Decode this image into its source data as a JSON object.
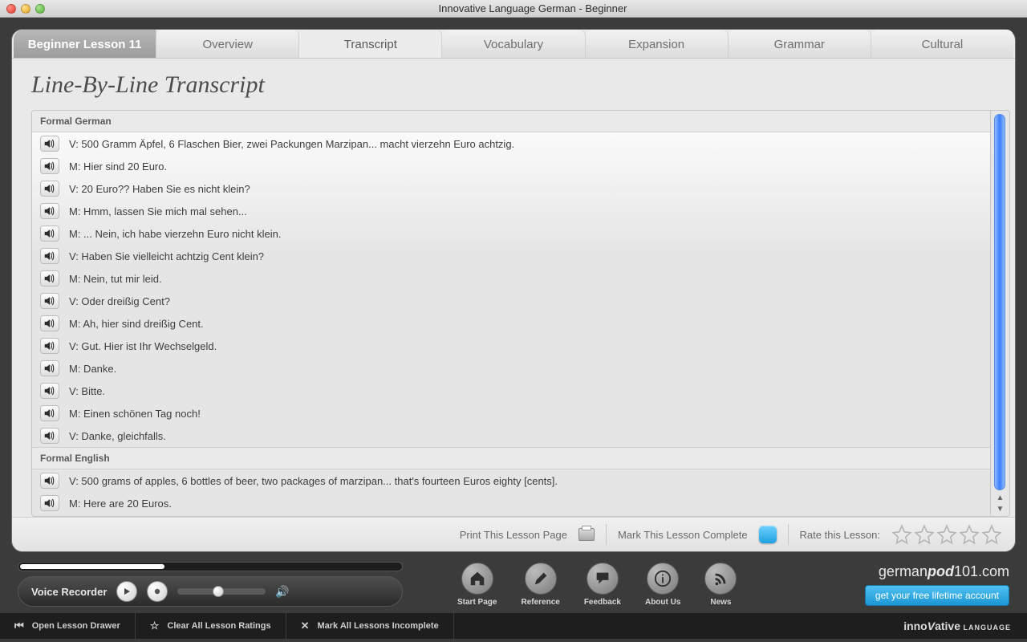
{
  "window": {
    "title": "Innovative Language German - Beginner"
  },
  "tabs": {
    "lead": "Beginner Lesson 11",
    "items": [
      "Overview",
      "Transcript",
      "Vocabulary",
      "Expansion",
      "Grammar",
      "Cultural"
    ],
    "active_index": 1
  },
  "content": {
    "heading": "Line-By-Line Transcript",
    "sections": [
      {
        "title": "Formal German",
        "lines": [
          "V: 500 Gramm Äpfel, 6 Flaschen Bier, zwei Packungen Marzipan... macht vierzehn Euro achtzig.",
          "M: Hier sind 20 Euro.",
          "V: 20 Euro?? Haben Sie es nicht klein?",
          "M: Hmm, lassen Sie mich mal sehen...",
          "M: ... Nein, ich habe vierzehn Euro nicht klein.",
          "V: Haben Sie vielleicht achtzig Cent klein?",
          "M: Nein, tut mir leid.",
          "V: Oder dreißig Cent?",
          "M: Ah, hier sind dreißig Cent.",
          "V: Gut. Hier ist Ihr Wechselgeld.",
          "M: Danke.",
          "V: Bitte.",
          "M: Einen schönen Tag noch!",
          "V: Danke, gleichfalls."
        ]
      },
      {
        "title": "Formal English",
        "lines": [
          "V: 500 grams of apples, 6 bottles of beer, two packages of marzipan... that's fourteen Euros eighty [cents].",
          "M: Here are 20 Euros."
        ]
      }
    ]
  },
  "actionbar": {
    "print": "Print This Lesson Page",
    "complete": "Mark This Lesson Complete",
    "rate": "Rate this Lesson:"
  },
  "voicerec": {
    "label": "Voice Recorder"
  },
  "nav": [
    {
      "id": "start-page",
      "label": "Start Page",
      "icon": "home"
    },
    {
      "id": "reference",
      "label": "Reference",
      "icon": "pen"
    },
    {
      "id": "feedback",
      "label": "Feedback",
      "icon": "speech"
    },
    {
      "id": "about-us",
      "label": "About Us",
      "icon": "info"
    },
    {
      "id": "news",
      "label": "News",
      "icon": "rss"
    }
  ],
  "promo": {
    "domain": "germanpod101.com",
    "cta": "get your free lifetime account"
  },
  "bottombar": {
    "open_drawer": "Open Lesson Drawer",
    "clear_ratings": "Clear All Lesson Ratings",
    "mark_incomplete": "Mark All Lessons Incomplete",
    "brand_pre": "inno",
    "brand_v": "V",
    "brand_post": "ative",
    "brand_word2": " LANGUAGE"
  }
}
